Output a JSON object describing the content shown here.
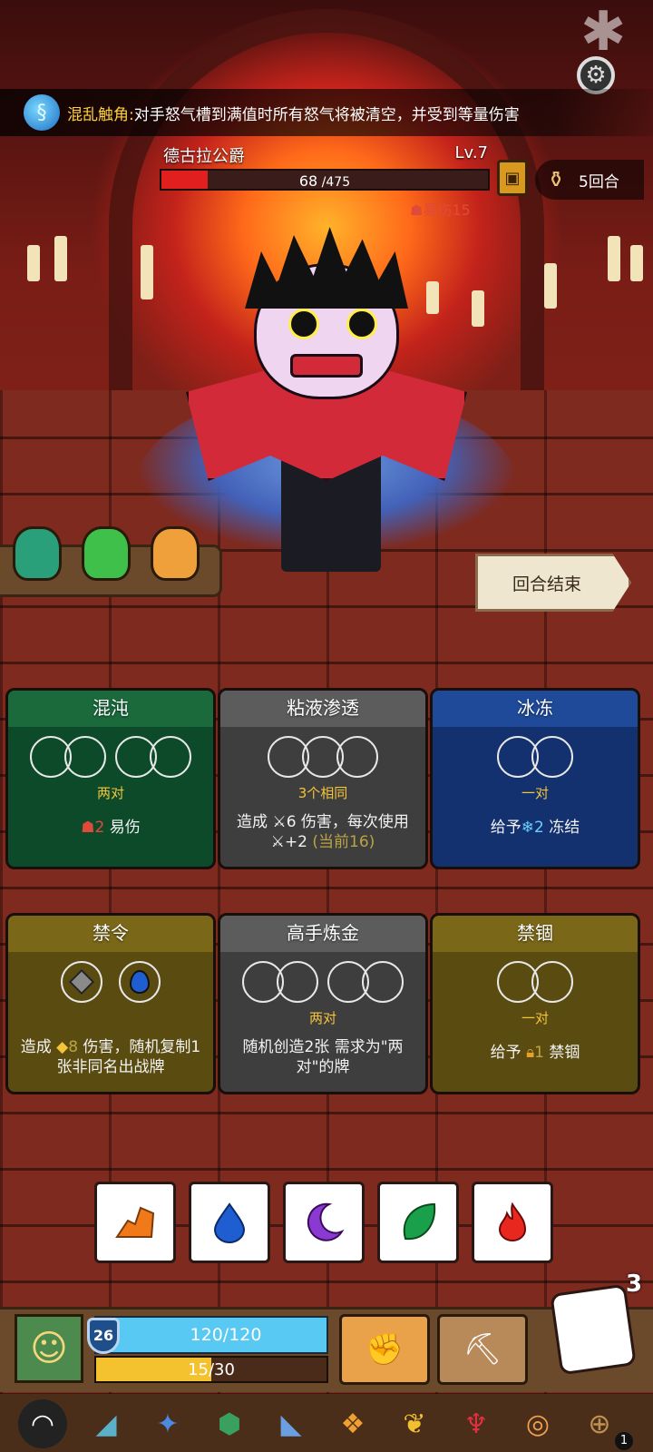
{
  "banner": {
    "skill_name": "混乱触角:",
    "skill_desc": "对手怒气槽到满值时所有怒气将被清空，并受到等量伤害"
  },
  "boss": {
    "name": "德古拉公爵",
    "level": "Lv.7",
    "hp_current": "68",
    "hp_max": " /475",
    "hp_fraction": 0.143,
    "status_text": "易伤",
    "status_value": "15"
  },
  "round": {
    "label": "5回合"
  },
  "end_turn": {
    "label": "回合结束"
  },
  "cards": [
    {
      "title": "混沌",
      "requirement": "两对",
      "effect_value": "2",
      "effect_text": " 易伤",
      "color": "#1a6a3c"
    },
    {
      "title": "粘液渗透",
      "requirement": "3个相同",
      "effect_line1": "造成 ",
      "effect_value": "6",
      "effect_line1b": " 伤害，每次使用",
      "effect_line2": "+2 ",
      "effect_current": "(当前16)",
      "color": "#5c5c5c"
    },
    {
      "title": "冰冻",
      "requirement": "一对",
      "effect_prefix": "给予",
      "effect_value": "2",
      "effect_text": " 冻结",
      "color": "#1f4a9a"
    },
    {
      "title": "禁令",
      "effect_prefix": "造成 ",
      "effect_value": "8",
      "effect_text": " 伤害，随机复制1张非同名出战牌",
      "color": "#7a6718"
    },
    {
      "title": "高手炼金",
      "requirement": "两对",
      "effect_text": "随机创造2张 需求为\"两对\"的牌",
      "color": "#5c5c5c"
    },
    {
      "title": "禁锢",
      "requirement": "一对",
      "effect_prefix": "给予 ",
      "effect_value": "1",
      "effect_text": " 禁锢",
      "color": "#7a6718"
    }
  ],
  "dice": [
    {
      "icon": "orange-rock-icon",
      "color": "#f07a1a"
    },
    {
      "icon": "blue-drop-icon",
      "color": "#1f5ed1"
    },
    {
      "icon": "purple-moon-icon",
      "color": "#8a3ad1"
    },
    {
      "icon": "green-leaf-icon",
      "color": "#1aa04a"
    },
    {
      "icon": "red-flame-icon",
      "color": "#e8281e"
    }
  ],
  "player": {
    "level": "26",
    "hp": "120/120",
    "xp": "15/30",
    "xp_fraction": 0.5
  },
  "dice_bag": {
    "count": "3"
  },
  "relic_badge": "1"
}
